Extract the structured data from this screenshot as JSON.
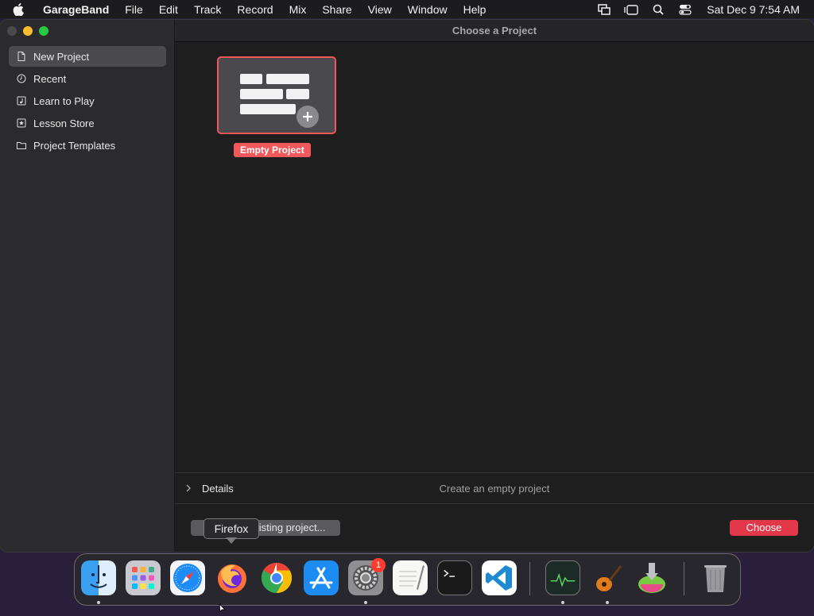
{
  "menubar": {
    "app_name": "GarageBand",
    "items": [
      "File",
      "Edit",
      "Track",
      "Record",
      "Mix",
      "Share",
      "View",
      "Window",
      "Help"
    ],
    "clock": "Sat Dec 9  7:54 AM"
  },
  "sidebar": {
    "items": [
      {
        "label": "New Project",
        "icon": "document-icon"
      },
      {
        "label": "Recent",
        "icon": "clock-icon"
      },
      {
        "label": "Learn to Play",
        "icon": "music-note-icon"
      },
      {
        "label": "Lesson Store",
        "icon": "star-icon"
      },
      {
        "label": "Project Templates",
        "icon": "folder-icon"
      }
    ]
  },
  "window": {
    "title": "Choose a Project"
  },
  "project_tile": {
    "label": "Empty Project"
  },
  "details": {
    "label": "Details",
    "description": "Create an empty project"
  },
  "buttons": {
    "open_existing": "Open an existing project...",
    "choose": "Choose"
  },
  "tooltip": {
    "text": "Firefox"
  },
  "dock": {
    "badge_system_settings": "1",
    "items": [
      "finder-icon",
      "launchpad-icon",
      "safari-icon",
      "firefox-icon",
      "chrome-icon",
      "app-store-icon",
      "system-settings-icon",
      "textedit-icon",
      "terminal-icon",
      "vscode-icon",
      "activity-monitor-icon",
      "garageband-icon",
      "installer-icon",
      "trash-icon"
    ]
  },
  "colors": {
    "accent": "#f0585c",
    "choose_button": "#e3384a",
    "sidebar_bg": "#2b2b2d",
    "window_bg": "#1e1e1e"
  }
}
